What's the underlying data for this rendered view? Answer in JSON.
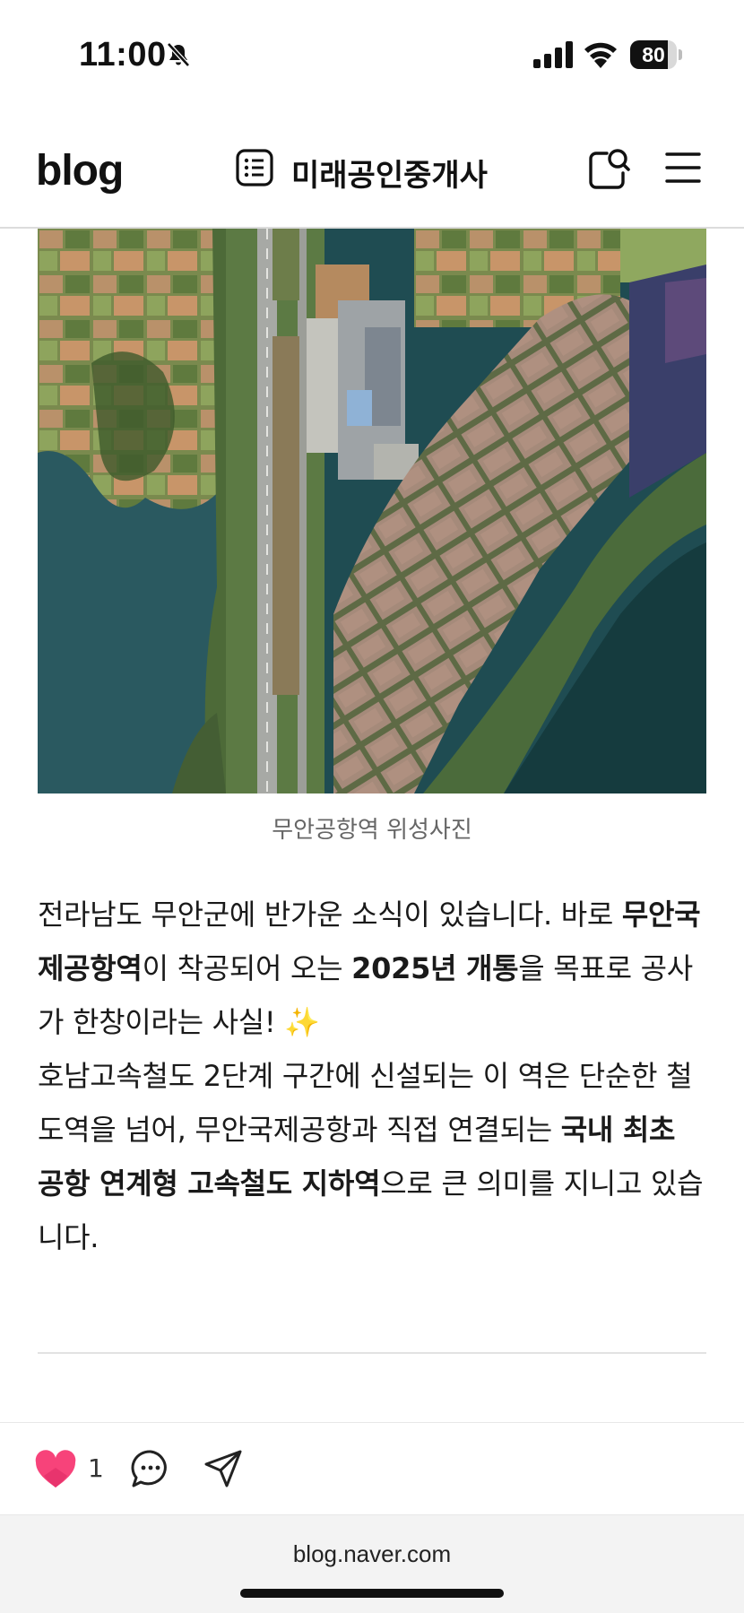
{
  "status_bar": {
    "time": "11:00",
    "battery_level": "80",
    "battery_fraction": 0.8,
    "icons": [
      "bell-slash-icon",
      "signal-icon",
      "wifi-icon",
      "battery-icon"
    ]
  },
  "header": {
    "logo": "blog",
    "blog_name": "미래공인중개사",
    "icons": [
      "list-icon",
      "search-icon",
      "menu-icon"
    ]
  },
  "photo": {
    "caption": "무안공항역 위성사진"
  },
  "article": {
    "p1": {
      "t1": "전라남도 무안군에 반가운 소식이 있습니다. 바로 ",
      "b1": "무안국제공항역",
      "t2": "이 착공되어 오는 ",
      "b2": "2025년 개통",
      "t3": "을 목표로 공사가 한창이라는 사실! ✨"
    },
    "p2": {
      "t1": "호남고속철도 2단계 구간에 신설되는 이 역은 단순한 철도역을 넘어, 무안국제공항과 직접 연결되는 ",
      "b1": "국내 최초 공항 연계형 고속철도 지하역",
      "t2": "으로 큰 의미를 지니고 있습니다."
    }
  },
  "actions": {
    "like_count": "1",
    "colors": {
      "heart": "#f7437a"
    }
  },
  "browser": {
    "url": "blog.naver.com"
  }
}
